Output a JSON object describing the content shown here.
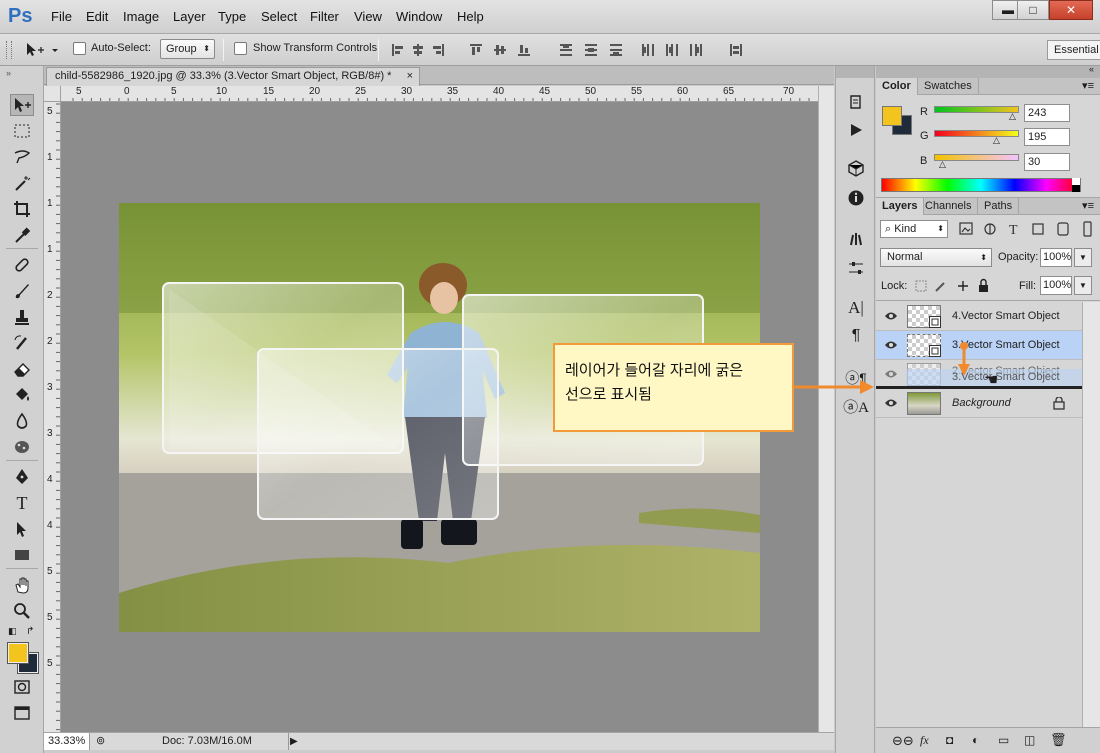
{
  "app": {
    "logo": "Ps",
    "workspace": "Essential"
  },
  "menu": [
    "File",
    "Edit",
    "Image",
    "Layer",
    "Type",
    "Select",
    "Filter",
    "View",
    "Window",
    "Help"
  ],
  "window_buttons": {
    "minimize": "▬",
    "maximize": "□",
    "close": "✕"
  },
  "options": {
    "auto_select_label": "Auto-Select:",
    "auto_select_value": "Group",
    "show_transform_label": "Show Transform Controls"
  },
  "document": {
    "tab_title": "child-5582986_1920.jpg @ 33.3% (3.Vector Smart Object, RGB/8#) *",
    "close": "×",
    "ruler_h": [
      "5",
      "0",
      "5",
      "10",
      "15",
      "20",
      "25",
      "30",
      "35",
      "40",
      "45",
      "50",
      "55",
      "60",
      "65",
      "70"
    ],
    "ruler_v": [
      "5",
      "1",
      "1",
      "1",
      "2",
      "2",
      "3",
      "3",
      "4",
      "4",
      "5",
      "5",
      "5"
    ]
  },
  "status": {
    "zoom": "33.33%",
    "doc": "Doc: 7.03M/16.0M"
  },
  "color_panel": {
    "tabs": [
      "Color",
      "Swatches"
    ],
    "foreground": "#f3c31e",
    "background": "#1f2a3a",
    "r_label": "R",
    "g_label": "G",
    "b_label": "B",
    "r": "243",
    "g": "195",
    "b": "30"
  },
  "layers_panel": {
    "tabs": [
      "Layers",
      "Channels",
      "Paths"
    ],
    "kind": "Kind",
    "blend_mode": "Normal",
    "opacity_label": "Opacity:",
    "opacity": "100%",
    "lock_label": "Lock:",
    "fill_label": "Fill:",
    "fill": "100%",
    "layers": [
      {
        "name": "4.Vector Smart Object",
        "selected": false
      },
      {
        "name": "3.Vector Smart Object",
        "selected": true
      },
      {
        "name": "2.Vector Smart Object",
        "ghost": "3.Vector Smart Object",
        "selected": false
      },
      {
        "name": "Background",
        "selected": false
      }
    ]
  },
  "annotation": {
    "line1": "레이어가 들어갈 자리에 굵은",
    "line2": "선으로 표시됨"
  },
  "colors": {
    "accent": "#f08a2c",
    "selection": "#b9d2f5"
  }
}
